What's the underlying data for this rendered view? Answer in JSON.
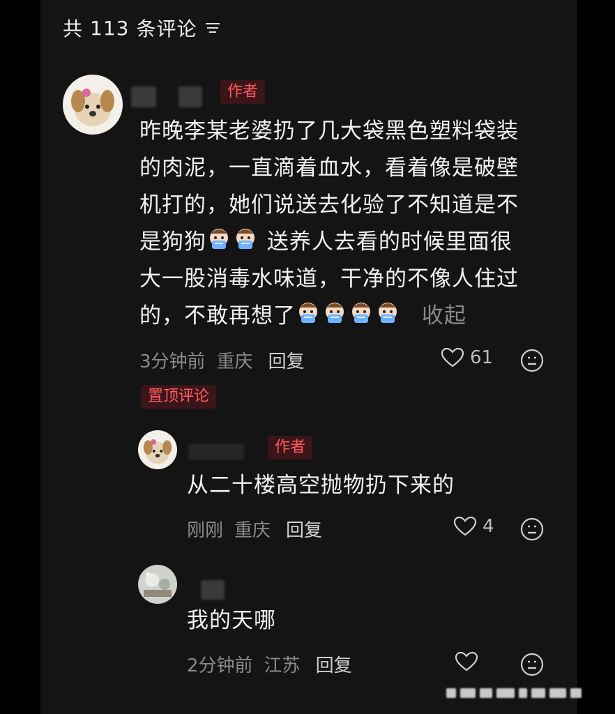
{
  "header": {
    "prefix": "共",
    "count": "113",
    "suffix": "条评论",
    "filter_icon": "filter-lines-icon"
  },
  "comments": [
    {
      "tag": "作者",
      "text_lines": [
        "昨晚李某老婆扔了几大袋黑色塑料袋装",
        "的肉泥，一直滴着血水，看着像是破壁",
        "机打的，她们说送去化验了不知道是不",
        "是狗狗",
        "送养人去看的时候里面很",
        "大一股消毒水味道，干净的不像人住过",
        "的，不敢再想了"
      ],
      "collapse": "收起",
      "time": "3分钟前",
      "location": "重庆",
      "reply": "回复",
      "likes": "61",
      "pinned": "置顶评论"
    },
    {
      "tag": "作者",
      "text": "从二十楼高空抛物扔下来的",
      "time": "刚刚",
      "location": "重庆",
      "reply": "回复",
      "likes": "4"
    },
    {
      "text": "我的天哪",
      "time": "2分钟前",
      "location": "江苏",
      "reply": "回复",
      "likes": ""
    }
  ],
  "icons": {
    "heart": "heart-outline-icon",
    "emoji": "smiley-face-icon",
    "crying": "crying-emoji-icon"
  },
  "colors": {
    "background": "#141414",
    "tag_text": "#ff5b63",
    "tag_bg": "#3b1518",
    "muted": "#8a8a8a"
  }
}
